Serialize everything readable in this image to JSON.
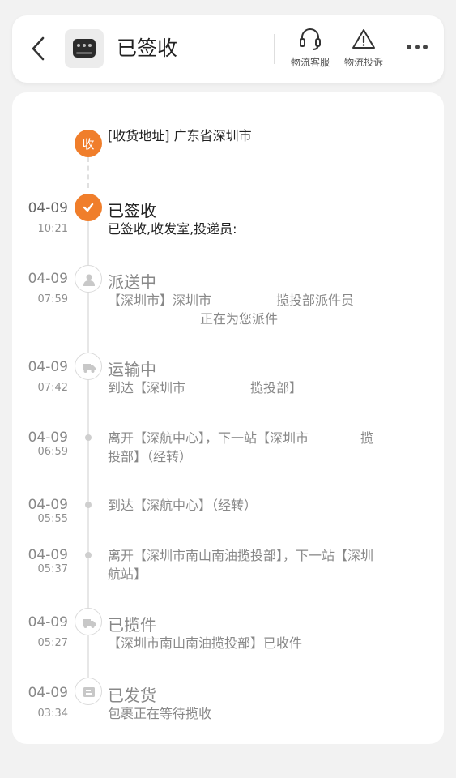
{
  "header": {
    "title": "已签收",
    "actions": [
      {
        "label": "物流客服",
        "icon": "headset-icon"
      },
      {
        "label": "物流投诉",
        "icon": "warning-icon"
      }
    ],
    "more_icon": "more-icon",
    "back_icon": "back-icon",
    "product_icon": "product-thumbnail"
  },
  "colors": {
    "accent": "#f07e2b",
    "muted": "#888888",
    "text": "#222222"
  },
  "address": {
    "badge": "收",
    "text": "[收货地址] 广东省深圳市"
  },
  "events": [
    {
      "date": "04-09",
      "time": "10:21",
      "title": "已签收",
      "desc": "已签收,收发室,投递员:",
      "icon": "check-icon",
      "status": "current"
    },
    {
      "date": "04-09",
      "time": "07:59",
      "title": "派送中",
      "desc_line1": "【深圳市】深圳市　　　　　揽投部派件员",
      "desc_line2": "正在为您派件",
      "icon": "courier-icon"
    },
    {
      "date": "04-09",
      "time": "07:42",
      "title": "运输中",
      "desc": "到达【深圳市　　　　　揽投部】",
      "icon": "truck-icon"
    },
    {
      "date": "04-09",
      "time": "06:59",
      "desc_line1": "离开【深航中心】，下一站【深圳市　　　　揽",
      "desc_line2": "投部】（经转）"
    },
    {
      "date": "04-09",
      "time": "05:55",
      "desc": "到达【深航中心】（经转）"
    },
    {
      "date": "04-09",
      "time": "05:37",
      "desc_line1": "离开【深圳市南山南油揽投部】，下一站【深圳",
      "desc_line2": "航站】"
    },
    {
      "date": "04-09",
      "time": "05:27",
      "title": "已揽件",
      "desc": "【深圳市南山南油揽投部】已收件",
      "icon": "pickup-truck-icon"
    },
    {
      "date": "04-09",
      "time": "03:34",
      "title": "已发货",
      "desc": "包裹正在等待揽收",
      "icon": "shipped-box-icon"
    }
  ]
}
